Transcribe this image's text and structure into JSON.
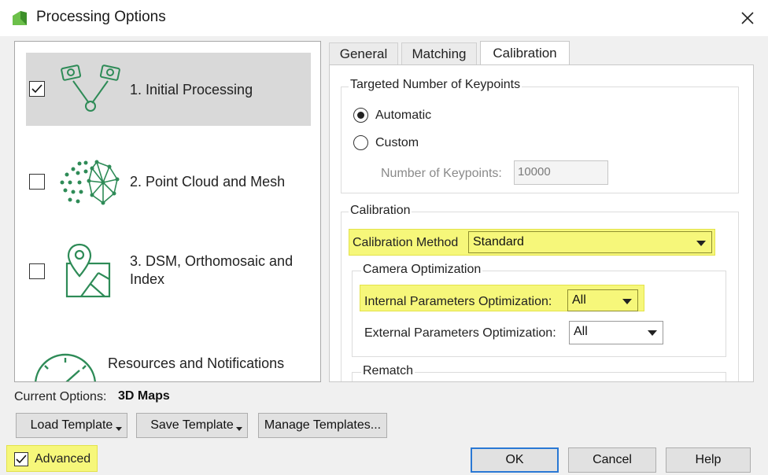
{
  "window": {
    "title": "Processing Options",
    "app_icon": "pix4d-app-icon",
    "close_icon": "close-icon"
  },
  "steps": [
    {
      "label": "1. Initial Processing",
      "checked": true,
      "selected": true,
      "icon": "initial-processing-icon"
    },
    {
      "label": "2. Point Cloud and Mesh",
      "checked": false,
      "selected": false,
      "icon": "point-cloud-icon"
    },
    {
      "label_line1": "3. DSM, Orthomosaic and",
      "label_line2": "Index",
      "checked": false,
      "selected": false,
      "icon": "dsm-map-icon"
    },
    {
      "label": "Resources and Notifications",
      "icon": "speedometer-icon"
    }
  ],
  "tabs": [
    {
      "label": "General",
      "active": false
    },
    {
      "label": "Matching",
      "active": false
    },
    {
      "label": "Calibration",
      "active": true
    }
  ],
  "keypoints": {
    "group_title": "Targeted Number of Keypoints",
    "automatic_label": "Automatic",
    "custom_label": "Custom",
    "selected": "Automatic",
    "number_label": "Number of Keypoints:",
    "number_value": "10000"
  },
  "calibration": {
    "group_title": "Calibration",
    "method_label": "Calibration Method",
    "method_value": "Standard",
    "camera_opt_title": "Camera Optimization",
    "internal_label": "Internal Parameters Optimization:",
    "internal_value": "All",
    "external_label": "External Parameters Optimization:",
    "external_value": "All",
    "rematch_title": "Rematch"
  },
  "footer": {
    "current_options_label": "Current Options:",
    "current_options_value": "3D Maps",
    "load_template": "Load Template",
    "save_template": "Save Template",
    "manage_templates": "Manage Templates...",
    "advanced_label": "Advanced",
    "advanced_checked": true,
    "ok": "OK",
    "cancel": "Cancel",
    "help": "Help"
  },
  "colors": {
    "highlight": "#f6f77a",
    "icon_green": "#2e8b57",
    "selected_row": "#d9d9d9",
    "default_button_border": "#2a78d4"
  }
}
